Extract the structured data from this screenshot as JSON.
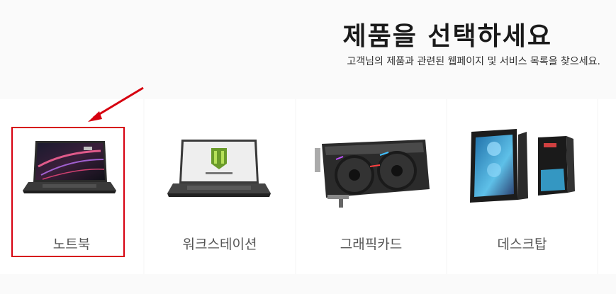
{
  "header": {
    "title": "제품을 선택하세요",
    "subtitle": "고객님의 제품과 관련된 웹페이지 및 서비스 목록을 찾으세요."
  },
  "categories": [
    {
      "label": "노트북",
      "icon": "laptop-icon"
    },
    {
      "label": "워크스테이션",
      "icon": "workstation-laptop-icon"
    },
    {
      "label": "그래픽카드",
      "icon": "graphics-card-icon"
    },
    {
      "label": "데스크탑",
      "icon": "desktop-pc-icon"
    }
  ],
  "annotation": {
    "color": "#d6000f",
    "target": "노트북"
  }
}
